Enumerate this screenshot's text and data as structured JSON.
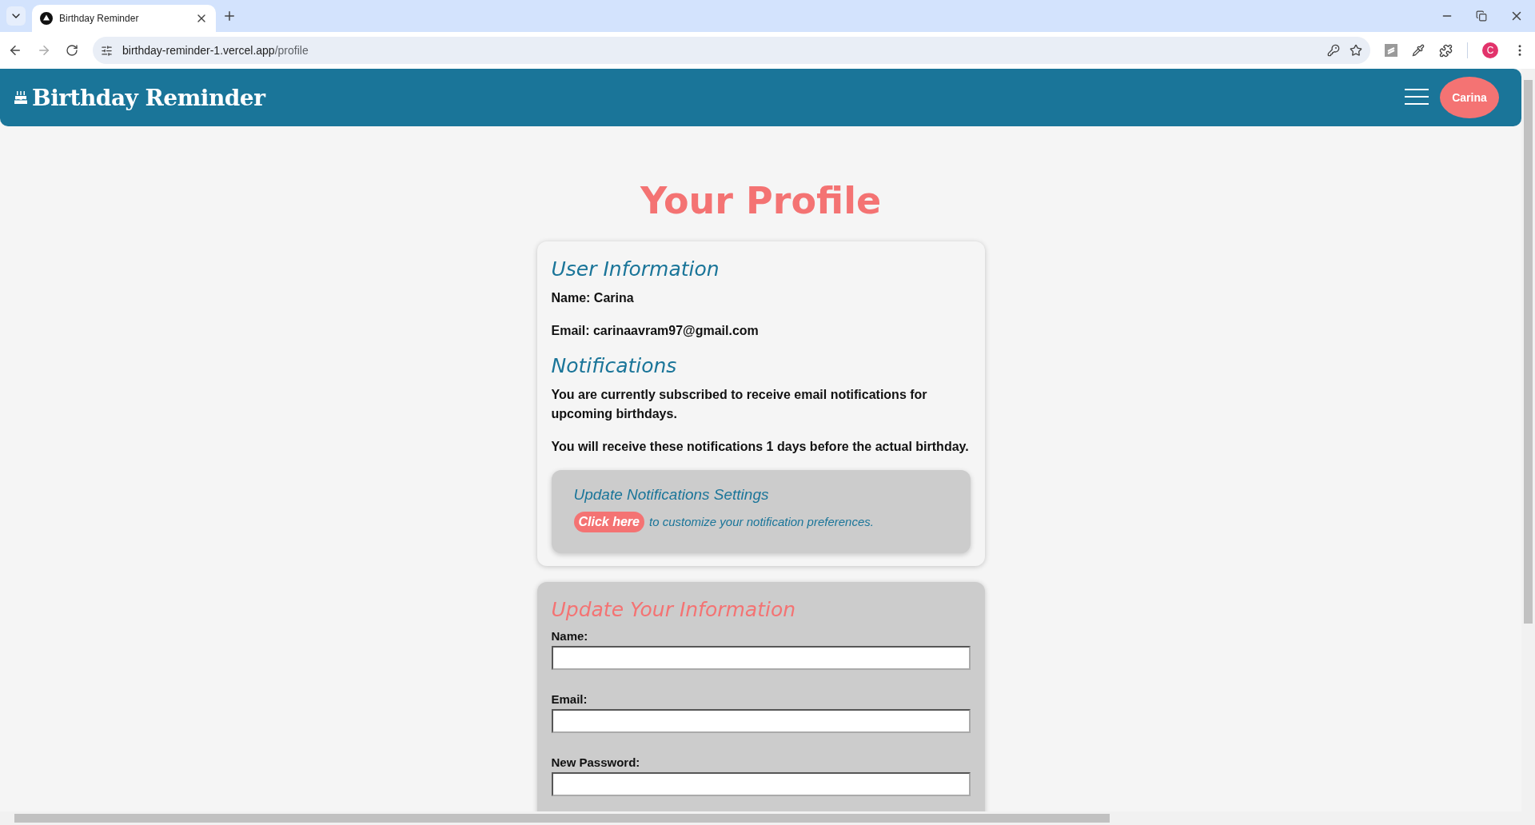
{
  "browser": {
    "tab_title": "Birthday Reminder",
    "url_host": "birthday-reminder-1.vercel.app",
    "url_path": "/profile",
    "profile_initial": "C"
  },
  "header": {
    "title": "Birthday Reminder",
    "user_button": "Carina"
  },
  "page_title": "Your Profile",
  "user_information": {
    "heading": "User Information",
    "name": "Name: Carina",
    "email": "Email: carinaavram97@gmail.com"
  },
  "notifications": {
    "heading": "Notifications",
    "subscribed_text": "You are currently subscribed to receive email notifications for upcoming birthdays.",
    "timing_text": "You will receive these notifications 1 days before the actual birthday.",
    "settings_box": {
      "heading": "Update Notifications Settings",
      "link": "Click here",
      "text": "to customize your notification preferences."
    }
  },
  "update_form": {
    "heading": "Update Your Information",
    "fields": [
      {
        "label": "Name:"
      },
      {
        "label": "Email:"
      },
      {
        "label": "New Password:"
      }
    ]
  }
}
